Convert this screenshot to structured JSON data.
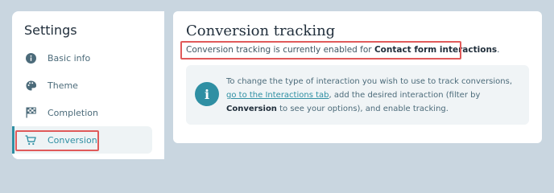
{
  "sidebar": {
    "title": "Settings",
    "items": [
      {
        "label": "Basic info",
        "icon": "info-circle-icon"
      },
      {
        "label": "Theme",
        "icon": "palette-icon"
      },
      {
        "label": "Completion",
        "icon": "checkered-flag-icon"
      },
      {
        "label": "Conversion",
        "icon": "cart-icon"
      }
    ]
  },
  "main": {
    "title": "Conversion tracking",
    "status_prefix": "Conversion tracking is currently enabled for ",
    "status_bold": "Contact form interactions",
    "status_suffix": ".",
    "info": {
      "text1": "To change the type of interaction you wish to use to track conversions, ",
      "link": "go to the Interactions tab",
      "text2": ", add the desired interaction (filter by ",
      "bold": "Conversion",
      "text3": " to see your options), and enable tracking."
    }
  },
  "colors": {
    "accent": "#2f8fa3",
    "highlight": "#e05a5a",
    "background": "#c9d6e0"
  }
}
